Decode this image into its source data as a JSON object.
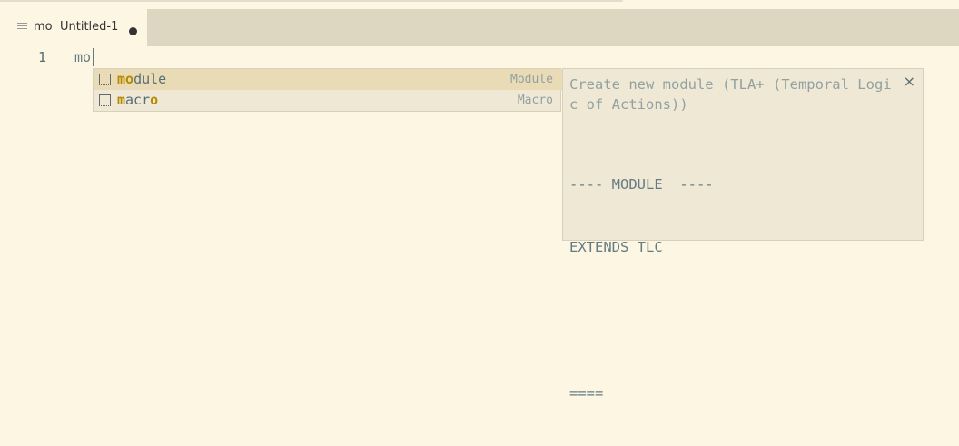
{
  "tab": {
    "language": "mo",
    "title": "Untitled-1",
    "dirty": true
  },
  "editor": {
    "line_number": "1",
    "line_text": "mo"
  },
  "suggestions": [
    {
      "label_match": "mo",
      "label_rest": "dule",
      "detail": "Module",
      "selected": true
    },
    {
      "label_match": "m",
      "label_mid": "acr",
      "label_match2": "o",
      "detail": "Macro",
      "selected": false
    }
  ],
  "details": {
    "doc": "Create new module (TLA+ (Temporal Logic of Actions))",
    "code_line1": "---- MODULE  ----",
    "code_line2": "EXTENDS TLC",
    "code_line3": "====",
    "close_glyph": "×"
  },
  "colors": {
    "background": "#fdf6e3",
    "tabbar": "#ddd6c1",
    "widget": "#eee8d5",
    "selected_row": "#e8dbb5",
    "match_highlight": "#b58900"
  }
}
